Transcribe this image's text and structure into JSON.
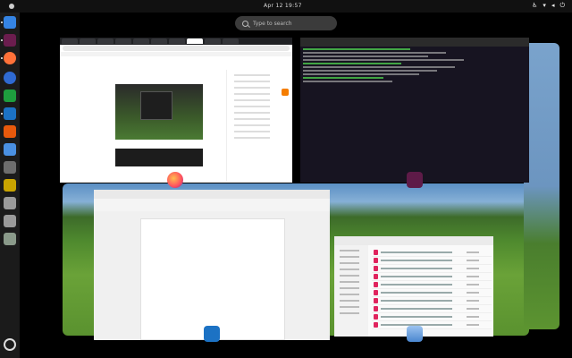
{
  "topbar": {
    "clock": "Apr 12  19:57"
  },
  "search": {
    "placeholder": "Type to search"
  },
  "dock": {
    "items": [
      {
        "name": "files",
        "color": "#3584e4"
      },
      {
        "name": "terminal",
        "color": "#6b1d4e"
      },
      {
        "name": "firefox",
        "color": "#ff7139"
      },
      {
        "name": "thunderbird",
        "color": "#2f6ad2"
      },
      {
        "name": "libreoffice-calc",
        "color": "#1e9e3e"
      },
      {
        "name": "libreoffice-writer",
        "color": "#1c72c4"
      },
      {
        "name": "libreoffice-impress",
        "color": "#e8590c"
      },
      {
        "name": "mail",
        "color": "#4a90e2"
      },
      {
        "name": "gimp",
        "color": "#6d6d6d"
      },
      {
        "name": "libreoffice-draw",
        "color": "#c9a400"
      },
      {
        "name": "blank-app-1",
        "color": "#9a9a9a"
      },
      {
        "name": "blank-app-2",
        "color": "#9a9a9a"
      },
      {
        "name": "trash",
        "color": "#8a9a8a"
      }
    ]
  }
}
